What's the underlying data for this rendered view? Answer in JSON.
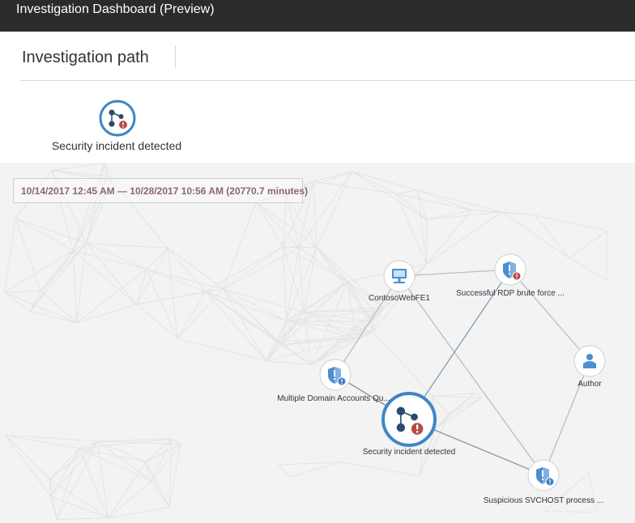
{
  "window": {
    "title": "Investigation Dashboard (Preview)"
  },
  "header": {
    "title": "Investigation path",
    "breadcrumb": [
      {
        "label": "Security incident detected",
        "icon": "incident-icon"
      }
    ]
  },
  "time_range": {
    "text": "10/14/2017 12:45 AM — 10/28/2017 10:56 AM (20770.7 minutes)"
  },
  "graph": {
    "nodes": [
      {
        "id": "contosowebfe1",
        "label": "ContosoWebFE1",
        "icon": "computer-icon"
      },
      {
        "id": "rdp",
        "label": "Successful RDP brute force ...",
        "icon": "alert-shield-icon",
        "severity": "high"
      },
      {
        "id": "author",
        "label": "Author",
        "icon": "user-icon"
      },
      {
        "id": "domain",
        "label": "Multiple Domain Accounts Qu...",
        "icon": "alert-shield-icon",
        "severity": "info"
      },
      {
        "id": "incident",
        "label": "Security incident detected",
        "icon": "incident-icon",
        "severity": "high",
        "selected": true
      },
      {
        "id": "svchost",
        "label": "Suspicious SVCHOST process ...",
        "icon": "alert-shield-icon",
        "severity": "info"
      }
    ],
    "edges": [
      [
        "contosowebfe1",
        "rdp"
      ],
      [
        "contosowebfe1",
        "domain"
      ],
      [
        "contosowebfe1",
        "svchost"
      ],
      [
        "rdp",
        "author"
      ],
      [
        "rdp",
        "incident"
      ],
      [
        "author",
        "svchost"
      ],
      [
        "domain",
        "incident"
      ],
      [
        "incident",
        "svchost"
      ]
    ]
  },
  "colors": {
    "titlebar": "#2b2b2b",
    "selected_ring": "#3d86c6",
    "alert_high": "#b74a48",
    "alert_info": "#3b7fc4",
    "icon_blue": "#4a90d1"
  }
}
